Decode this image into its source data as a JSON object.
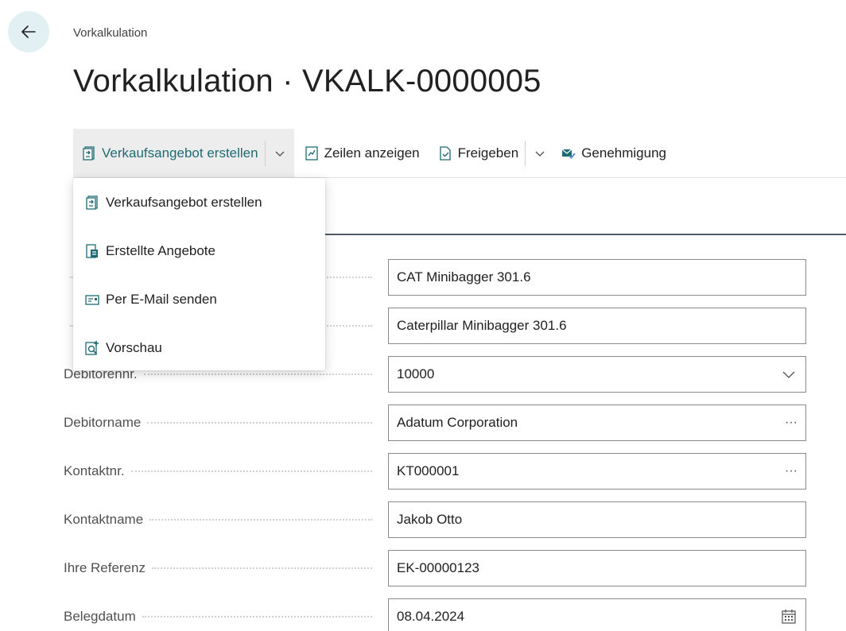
{
  "breadcrumb": "Vorkalkulation",
  "title": "Vorkalkulation · VKALK-0000005",
  "actions": {
    "create_quote": "Verkaufsangebot erstellen",
    "show_lines": "Zeilen anzeigen",
    "release": "Freigeben",
    "approval": "Genehmigung"
  },
  "menu": {
    "items": [
      {
        "label": "Verkaufsangebot erstellen",
        "icon": "quote-create-icon"
      },
      {
        "label": "Erstellte Angebote",
        "icon": "quotes-list-icon"
      },
      {
        "label": "Per E-Mail senden",
        "icon": "email-icon"
      },
      {
        "label": "Vorschau",
        "icon": "preview-icon"
      }
    ]
  },
  "fields": {
    "rows": [
      {
        "label": "",
        "value": "CAT Minibagger 301.6"
      },
      {
        "label": "",
        "value": "Caterpillar Minibagger 301.6"
      },
      {
        "label": "Debitorennr.",
        "value": "10000",
        "suffix": "dropdown"
      },
      {
        "label": "Debitorname",
        "value": "Adatum Corporation",
        "suffix": "···"
      },
      {
        "label": "Kontaktnr.",
        "value": "KT000001",
        "suffix": "···"
      },
      {
        "label": "Kontaktname",
        "value": "Jakob Otto"
      },
      {
        "label": "Ihre Referenz",
        "value": "EK-00000123"
      },
      {
        "label": "Belegdatum",
        "value": "08.04.2024",
        "suffix": "calendar"
      }
    ]
  },
  "colors": {
    "accent": "#1f6b74",
    "back_bg": "#e3f0f3"
  }
}
